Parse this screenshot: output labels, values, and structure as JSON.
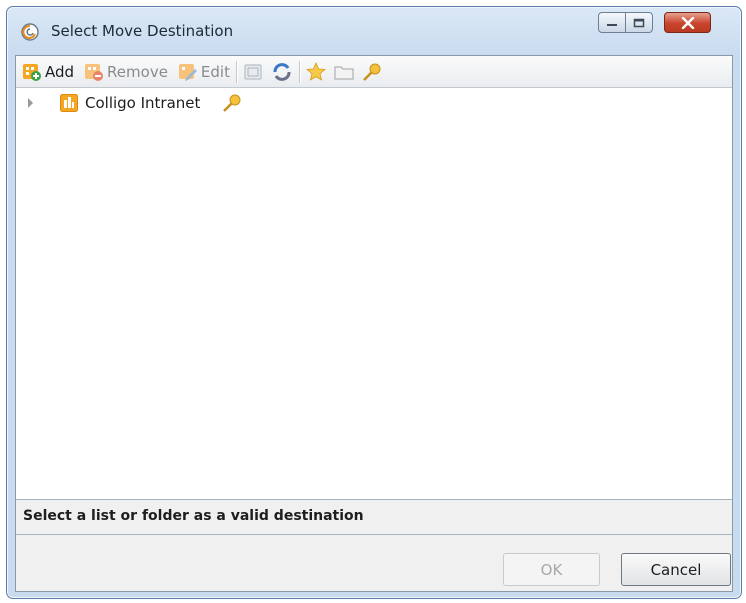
{
  "window": {
    "title": "Select Move Destination",
    "controls": {
      "minimize": "minimize-icon",
      "maximize": "maximize-icon",
      "close": "close-icon"
    }
  },
  "toolbar": {
    "add_label": "Add",
    "remove_label": "Remove",
    "edit_label": "Edit"
  },
  "tree": {
    "nodes": [
      {
        "label": "Colligo Intranet",
        "icon": "site-icon",
        "expanded": false,
        "badge": "key-icon"
      }
    ]
  },
  "status": {
    "message": "Select a list or folder as a valid destination"
  },
  "buttons": {
    "ok_label": "OK",
    "ok_enabled": false,
    "cancel_label": "Cancel"
  },
  "colors": {
    "accent_orange": "#f5a623",
    "title_bar": "#c9dbef",
    "close_button": "#c9452d"
  }
}
